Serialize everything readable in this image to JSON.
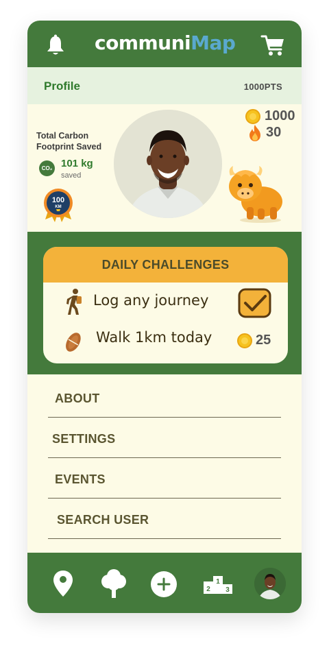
{
  "header": {
    "logo_part1": "communi",
    "logo_part2": "Map",
    "logo_color_primary": "#ffffff",
    "logo_color_accent": "#5aa9cf"
  },
  "profile_bar": {
    "label": "Profile",
    "points": "1000PTS"
  },
  "stats": {
    "carbon_title": "Total Carbon Footprint Saved",
    "co2_badge": "CO₂",
    "carbon_value": "101 kg",
    "carbon_unit": "saved",
    "distance_badge": "100",
    "distance_badge_unit": "KM",
    "coins": "1000",
    "streak": "30"
  },
  "challenges": {
    "title": "DAILY CHALLENGES",
    "items": [
      {
        "label": "Log any journey",
        "icon": "walking-person-icon",
        "completed": true
      },
      {
        "label": "Walk 1km today",
        "icon": "footprint-icon",
        "reward": "25"
      }
    ]
  },
  "menu": {
    "items": [
      "ABOUT",
      "SETTINGS",
      "EVENTS",
      "SEARCH USER"
    ]
  },
  "bottom_nav": {
    "items": [
      "map-pin-icon",
      "tree-icon",
      "add-icon",
      "podium-icon",
      "profile-avatar"
    ],
    "podium_labels": [
      "2",
      "1",
      "3"
    ]
  },
  "colors": {
    "primary_green": "#447a3c",
    "accent_orange": "#f3b23a",
    "background_cream": "#fdfbe6",
    "profile_bar": "#e6f2df"
  }
}
